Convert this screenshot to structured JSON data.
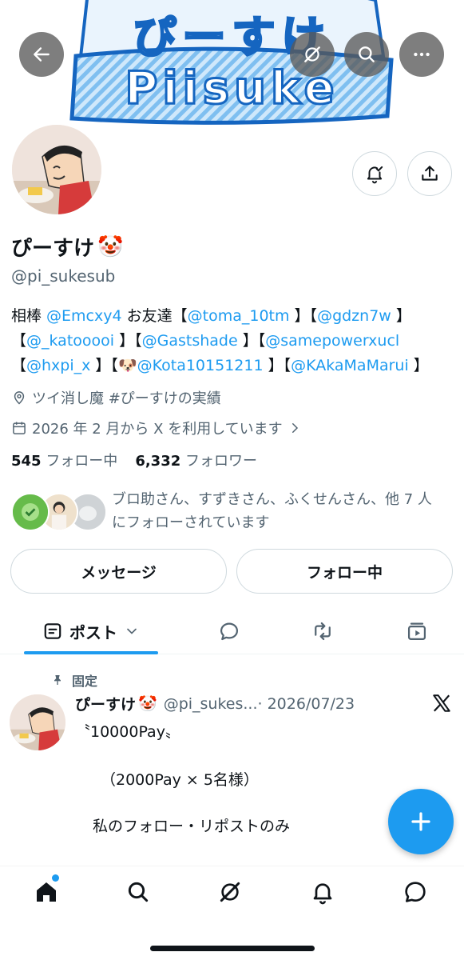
{
  "banner": {
    "logo_top": "ぴーすけ",
    "logo_bottom": "Piisuke"
  },
  "profile": {
    "name": "ぴーすけ",
    "name_emoji": "🤡",
    "handle": "@pi_sukesub",
    "bio": {
      "line1_prefix": "相棒 ",
      "line1_mention1": "@Emcxy4",
      "line1_mid": " お友達【",
      "line1_mention2": "@toma_10tm",
      "line1_sep": " 】【",
      "line1_mention3": "@gdzn7w",
      "line1_end": " 】",
      "line2_start": "【",
      "line2_mention1": "@_katooooi",
      "line2_sep1": " 】【",
      "line2_mention2": "@Gastshade",
      "line2_sep2": " 】【",
      "line2_mention3": "@samepowerxucl",
      "line3_start": "【",
      "line3_mention1": "@hxpi_x",
      "line3_sep1": " 】【",
      "line3_emoji": "🐶",
      "line3_mention2": "@Kota10151211",
      "line3_sep2": " 】【",
      "line3_mention3": "@KAkaMaMarui",
      "line3_end": " 】"
    },
    "location": "ツイ消し魔 #ぴーすけの実績",
    "joined": "2026 年 2 月から X を利用しています",
    "following_count": "545",
    "following_label": "フォロー中",
    "followers_count": "6,332",
    "followers_label": "フォロワー",
    "followed_by_line1": "ブロ助さん、すずきさん、ふくせんさん、他 7 人",
    "followed_by_line2": "にフォローされています"
  },
  "buttons": {
    "message": "メッセージ",
    "following": "フォロー中"
  },
  "tabs": {
    "posts_label": "ポスト"
  },
  "pinned_post": {
    "pinned_label": "固定",
    "author_name": "ぴーすけ",
    "author_emoji": "🤡",
    "author_handle": "@pi_sukes...",
    "date": "· 2026/07/23",
    "line1": "〝10000Pay〟",
    "line2": "（2000Pay × 5名様）",
    "line3": "私のフォロー・リポストのみ"
  },
  "colors": {
    "accent": "#1d9bf0",
    "text": "#0f1419",
    "secondary": "#536471",
    "border": "#cfd9de"
  },
  "icons": {
    "back": "back-arrow-icon",
    "grok": "grok-icon",
    "search": "search-icon",
    "more": "more-icon",
    "notify": "bell-check-icon",
    "share": "share-icon",
    "location": "location-pin-icon",
    "calendar": "calendar-icon",
    "reply": "reply-icon",
    "repost": "repost-icon",
    "media": "media-icon",
    "pin": "pin-icon",
    "x": "x-logo-icon",
    "compose": "plus-icon",
    "home": "home-icon",
    "explore": "search-icon",
    "grok_nav": "grok-icon",
    "notifications": "bell-icon",
    "messages": "message-icon"
  }
}
